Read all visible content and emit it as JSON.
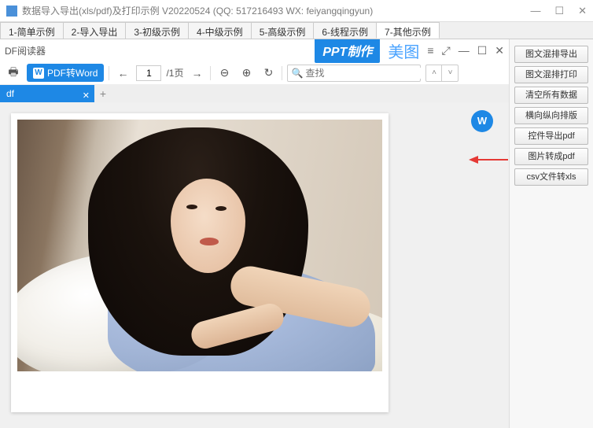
{
  "window": {
    "title": "数据导入导出(xls/pdf)及打印示例 V20220524 (QQ: 517216493 WX: feiyangqingyun)"
  },
  "tabs": {
    "items": [
      "1-简单示例",
      "2-导入导出",
      "3-初级示例",
      "4-中级示例",
      "5-高级示例",
      "6-线程示例",
      "7-其他示例"
    ],
    "active_index": 6
  },
  "reader": {
    "title": "DF阅读器",
    "ppt_badge": "PPT制作",
    "meitu_badge": "美图"
  },
  "toolbar": {
    "pdf_to_word": "PDF转Word",
    "page_current": "1",
    "page_total": "/1页",
    "search_placeholder": "查找"
  },
  "file_tab": {
    "name": "df"
  },
  "actions": {
    "items": [
      "图文混排导出",
      "图文混排打印",
      "清空所有数据",
      "横向纵向排版",
      "控件导出pdf",
      "图片转成pdf",
      "csv文件转xls"
    ]
  }
}
